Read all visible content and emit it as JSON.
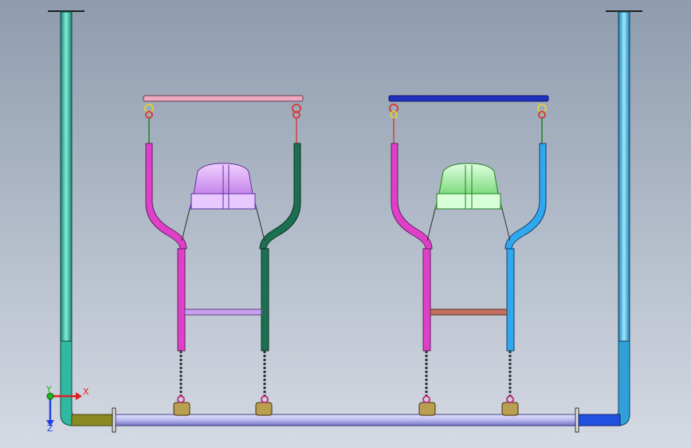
{
  "viewport": {
    "background_top": "#8e9cae",
    "background_bottom": "#d5dae3"
  },
  "triad": {
    "x_label": "X",
    "y_label": "Y",
    "z_label": "Z",
    "x_color": "#e02020",
    "y_color": "#20b020",
    "z_color": "#2040e0"
  },
  "colors": {
    "left_post": "#38c8b0",
    "right_post": "#40b8e0",
    "rail": "#b8b8f0",
    "left_coupler": "#8a8a20",
    "right_coupler": "#2050e0",
    "left_beam": "#f0a8c0",
    "right_beam": "#2030c0",
    "pink_frame": "#e040c8",
    "dark_green_frame": "#1a7050",
    "sky_blue_frame": "#30a8f0",
    "left_seat": "#d090f0",
    "right_seat": "#80e880",
    "left_crossbar": "#c8a0f0",
    "right_crossbar": "#c07060",
    "chain": "#303030",
    "wheel": "#b8a050",
    "hook": "#d04040",
    "hook_yellow": "#d8d040"
  }
}
